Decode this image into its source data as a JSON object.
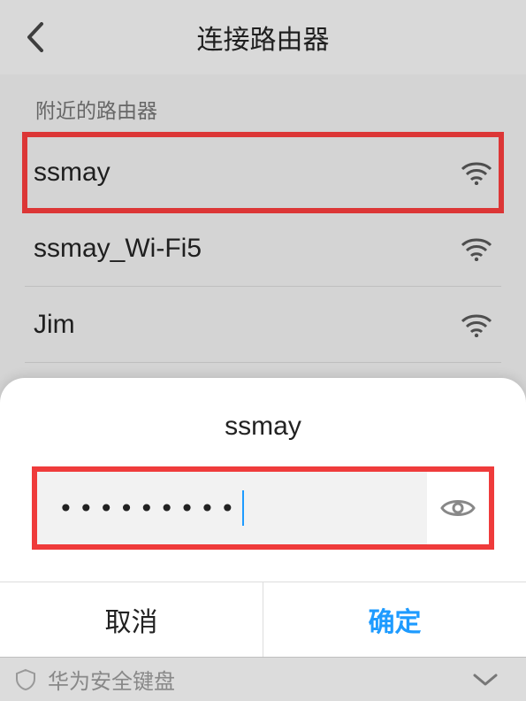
{
  "header": {
    "title": "连接路由器"
  },
  "section": {
    "label": "附近的路由器"
  },
  "wifi_list": [
    {
      "name": "ssmay",
      "highlighted": true
    },
    {
      "name": "ssmay_Wi-Fi5",
      "highlighted": false
    },
    {
      "name": "Jim",
      "highlighted": false
    }
  ],
  "dialog": {
    "title": "ssmay",
    "password_mask": "•••••••••",
    "cancel_label": "取消",
    "confirm_label": "确定"
  },
  "ime": {
    "label": "华为安全键盘"
  }
}
